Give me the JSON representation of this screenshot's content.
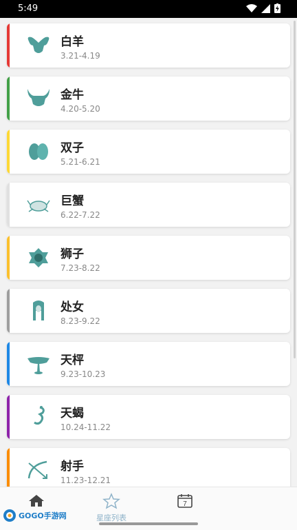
{
  "status": {
    "time": "5:49"
  },
  "signs": [
    {
      "name": "白羊",
      "date": "3.21-4.19",
      "color": "#e53935",
      "icon": "aries-icon"
    },
    {
      "name": "金牛",
      "date": "4.20-5.20",
      "color": "#43a047",
      "icon": "taurus-icon"
    },
    {
      "name": "双子",
      "date": "5.21-6.21",
      "color": "#fdd835",
      "icon": "gemini-icon"
    },
    {
      "name": "巨蟹",
      "date": "6.22-7.22",
      "color": "#e0e0e0",
      "icon": "cancer-icon"
    },
    {
      "name": "狮子",
      "date": "7.23-8.22",
      "color": "#fbc02d",
      "icon": "leo-icon"
    },
    {
      "name": "处女",
      "date": "8.23-9.22",
      "color": "#9e9e9e",
      "icon": "virgo-icon"
    },
    {
      "name": "天枰",
      "date": "9.23-10.23",
      "color": "#1e88e5",
      "icon": "libra-icon"
    },
    {
      "name": "天蝎",
      "date": "10.24-11.22",
      "color": "#8e24aa",
      "icon": "scorpio-icon"
    },
    {
      "name": "射手",
      "date": "11.23-12.21",
      "color": "#fb8c00",
      "icon": "sagittarius-icon"
    }
  ],
  "tabs": [
    {
      "label": "",
      "icon": "home-icon"
    },
    {
      "label": "星座列表",
      "icon": "star-icon"
    },
    {
      "label": "",
      "icon": "calendar-icon",
      "calendar_day": "7"
    }
  ],
  "watermark": {
    "text": "GOGO手游网"
  },
  "colors": {
    "icon_teal": "#4f9e9a",
    "tab_active": "#8fb3c9"
  }
}
